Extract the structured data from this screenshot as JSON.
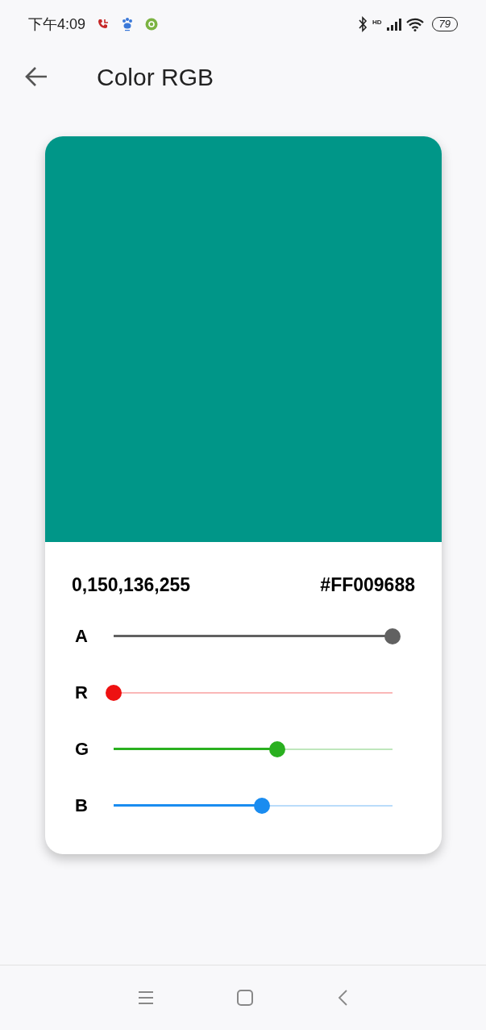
{
  "status_bar": {
    "time": "下午4:09",
    "network": "HD",
    "battery": "79"
  },
  "app_bar": {
    "title": "Color RGB"
  },
  "preview": {
    "color": "#009688"
  },
  "values": {
    "rgba": "0,150,136,255",
    "hex": "#FF009688"
  },
  "channels": [
    {
      "label": "A",
      "level": 1.0,
      "color": "#616161"
    },
    {
      "label": "R",
      "level": 0.0,
      "color": "#ee1111"
    },
    {
      "label": "G",
      "level": 0.588,
      "color": "#2ab020"
    },
    {
      "label": "B",
      "level": 0.533,
      "color": "#1a8cf0"
    }
  ]
}
